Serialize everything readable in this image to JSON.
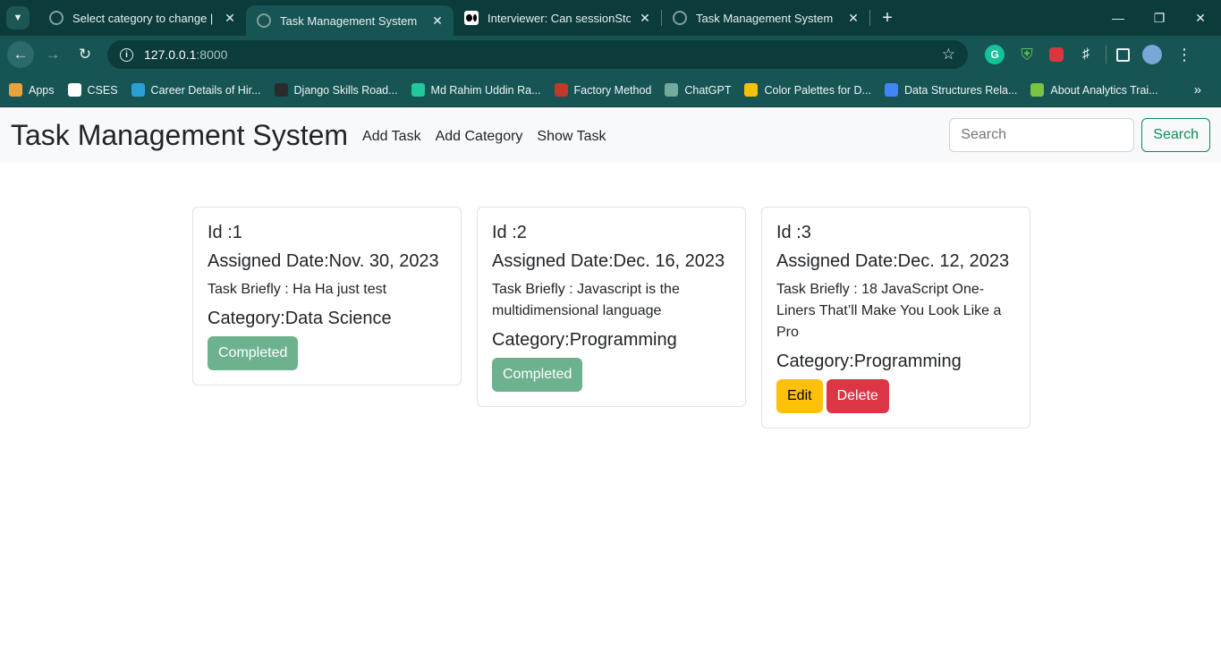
{
  "browser": {
    "tabs": [
      {
        "title": "Select category to change | Djan",
        "active": false,
        "icon": "globe-icon"
      },
      {
        "title": "Task Management System",
        "active": true,
        "icon": "globe-icon"
      },
      {
        "title": "Interviewer: Can sessionStorage",
        "active": false,
        "icon": "medium-icon"
      },
      {
        "title": "Task Management System",
        "active": false,
        "icon": "globe-icon"
      }
    ],
    "url_host": "127.0.0.1",
    "url_port": ":8000",
    "bookmarks": [
      {
        "label": "Apps",
        "icon": "apps-grid-icon",
        "color": "#e8a33d"
      },
      {
        "label": "CSES",
        "icon": "cses-icon",
        "color": "#ffffff"
      },
      {
        "label": "Career Details of Hir...",
        "icon": "career-icon",
        "color": "#2a9fd6"
      },
      {
        "label": "Django Skills Road...",
        "icon": "roadmap-icon",
        "color": "#2b2b2b"
      },
      {
        "label": "Md Rahim Uddin Ra...",
        "icon": "profile-icon",
        "color": "#20c997"
      },
      {
        "label": "Factory Method",
        "icon": "raccoon-icon",
        "color": "#c0392b"
      },
      {
        "label": "ChatGPT",
        "icon": "chatgpt-icon",
        "color": "#74aa9c"
      },
      {
        "label": "Color Palettes for D...",
        "icon": "palette-icon",
        "color": "#f4c20d"
      },
      {
        "label": "Data Structures Rela...",
        "icon": "docs-icon",
        "color": "#4285f4"
      },
      {
        "label": "About Analytics Trai...",
        "icon": "analytics-icon",
        "color": "#7cc243"
      }
    ]
  },
  "navbar": {
    "brand": "Task Management System",
    "links": [
      "Add Task",
      "Add Category",
      "Show Task"
    ],
    "search_placeholder": "Search",
    "search_button": "Search"
  },
  "tasks": [
    {
      "id_text": "Id :1",
      "date_text": "Assigned Date:Nov. 30, 2023",
      "brief_text": "Task Briefly : Ha Ha just test",
      "category_text": "Category:Data Science",
      "status_label": "Completed"
    },
    {
      "id_text": "Id :2",
      "date_text": "Assigned Date:Dec. 16, 2023",
      "brief_text": "Task Briefly : Javascript is the multidimensional language",
      "category_text": "Category:Programming",
      "status_label": "Completed"
    },
    {
      "id_text": "Id :3",
      "date_text": "Assigned Date:Dec. 12, 2023",
      "brief_text": "Task Briefly : 18 JavaScript One-Liners That’ll Make You Look Like a Pro",
      "category_text": "Category:Programming",
      "edit_label": "Edit",
      "delete_label": "Delete"
    }
  ]
}
